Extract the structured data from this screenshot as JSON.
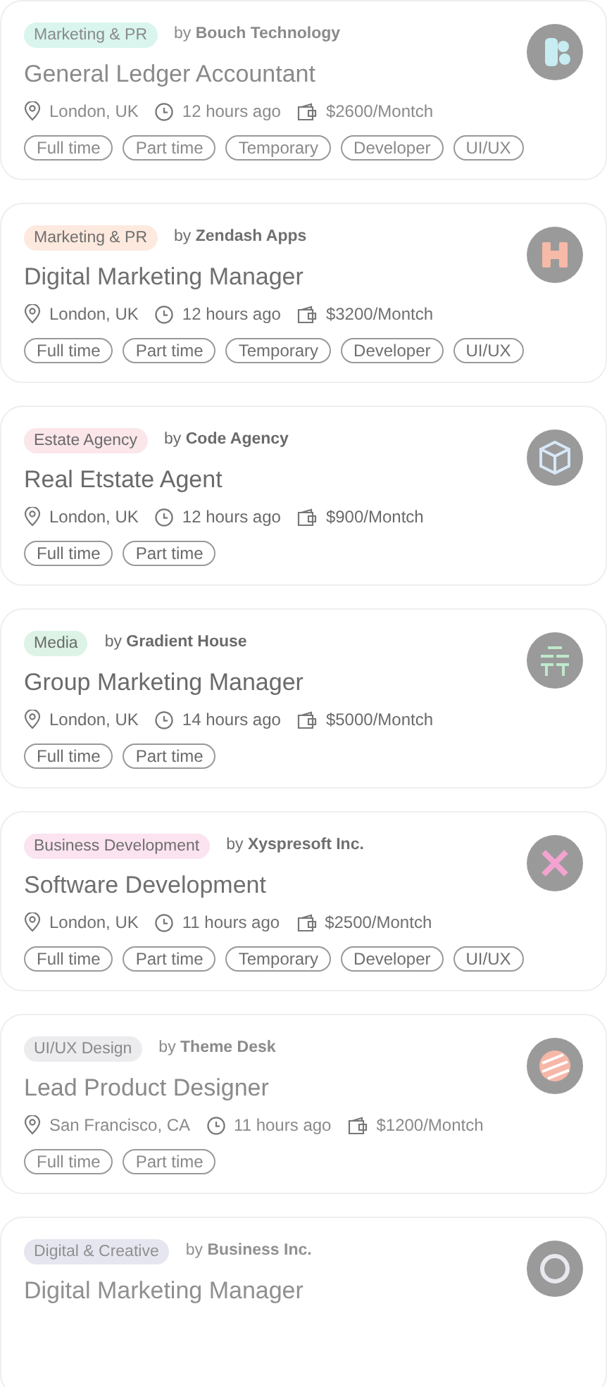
{
  "jobs": [
    {
      "category": "Marketing & PR",
      "color": "#d9f5ee",
      "company": "by **Bouch Technology**",
      "title": "General Ledger Accountant",
      "location": "London, UK",
      "posted": "12 hours ago",
      "salary": "$2600/Montch",
      "tags": [
        "Full time",
        "Part time",
        "Temporary",
        "Developer",
        "UI/UX"
      ]
    },
    {
      "category": "Marketing & PR",
      "color": "#fde9de",
      "company": "by **Zendash Apps**",
      "title": "Digital Marketing Manager",
      "location": "London, UK",
      "posted": "12 hours ago",
      "salary": "$3200/Montch",
      "tags": [
        "Full time",
        "Part time",
        "Temporary",
        "Developer",
        "UI/UX"
      ]
    },
    {
      "category": "Estate Agency",
      "color": "#fbe6ea",
      "company": "by **Code Agency**",
      "title": "Real Etstate Agent",
      "location": "London, UK",
      "posted": "12 hours ago",
      "salary": "$900/Montch",
      "tags": [
        "Full time",
        "Part time"
      ]
    },
    {
      "category": "Media",
      "color": "#dcf3e6",
      "company": "by **Gradient House**",
      "title": "Group Marketing Manager",
      "location": "London, UK",
      "posted": "14 hours ago",
      "salary": "$5000/Montch",
      "tags": [
        "Full time",
        "Part time"
      ]
    },
    {
      "category": "Business Development",
      "color": "#fbe3ef",
      "company": "by **Xyspresoft Inc.**",
      "title": "Software Development",
      "location": "London, UK",
      "posted": "11 hours ago",
      "salary": "$2500/Montch",
      "tags": [
        "Full time",
        "Part time",
        "Temporary",
        "Developer",
        "UI/UX"
      ]
    },
    {
      "category": "UI/UX Design",
      "color": "#ececef",
      "company": "by **Theme Desk**",
      "title": "Lead Product Designer",
      "location": "San Francisco, CA",
      "posted": "11 hours ago",
      "salary": "$1200/Montch",
      "tags": [
        "Full time",
        "Part time"
      ]
    },
    {
      "category": "Digital & Creative",
      "color": "#e6e6f0",
      "company": "by **Business Inc.**",
      "title": "Digital Marketing Manager"
    }
  ]
}
